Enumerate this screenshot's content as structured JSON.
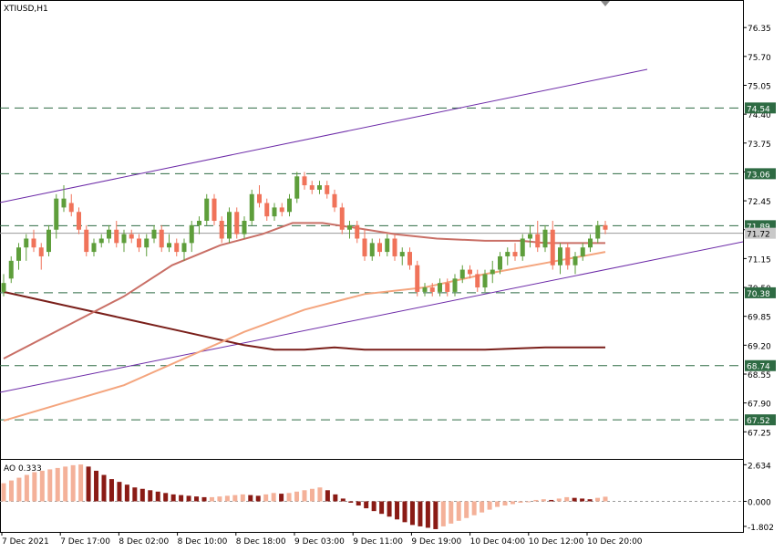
{
  "chart_data": {
    "type": "candlestick",
    "symbol": "XTIUSD,H1",
    "colors": {
      "up": "#5e9e3b",
      "down": "#f0735a",
      "ma_fast": "#c96f66",
      "ma_slow": "#f4a57e",
      "ma_long": "#7a1f1a",
      "channel": "#6d2ba8",
      "levels": "#2e6b43",
      "ao_up": "#f4b199",
      "ao_down": "#8a1b15"
    },
    "price_axis": {
      "ticks": [
        "76.35",
        "75.70",
        "75.05",
        "74.40",
        "73.75",
        "73.10",
        "72.45",
        "71.80",
        "71.15",
        "70.50",
        "69.85",
        "69.20",
        "68.55",
        "67.90",
        "67.25"
      ],
      "ylim": [
        66.64,
        76.97
      ]
    },
    "time_axis": {
      "labels": [
        "7 Dec 2021",
        "7 Dec 17:00",
        "8 Dec 02:00",
        "8 Dec 10:00",
        "8 Dec 18:00",
        "9 Dec 03:00",
        "9 Dec 11:00",
        "9 Dec 19:00",
        "10 Dec 04:00",
        "10 Dec 12:00",
        "10 Dec 20:00"
      ]
    },
    "levels": [
      {
        "label": "74.54",
        "value": 74.54
      },
      {
        "label": "73.06",
        "value": 73.06
      },
      {
        "label": "71.89",
        "value": 71.89
      },
      {
        "label": "70.38",
        "value": 70.38
      },
      {
        "label": "68.74",
        "value": 68.74
      },
      {
        "label": "67.52",
        "value": 67.52
      }
    ],
    "current_price": {
      "label": "71.72",
      "value": 71.72
    },
    "candles": [
      [
        70.4,
        70.8,
        70.3,
        70.6
      ],
      [
        70.7,
        71.2,
        70.6,
        71.1
      ],
      [
        71.1,
        71.5,
        70.9,
        71.4
      ],
      [
        71.4,
        71.7,
        71.1,
        71.6
      ],
      [
        71.6,
        71.8,
        71.3,
        71.4
      ],
      [
        71.4,
        71.5,
        70.9,
        71.2
      ],
      [
        71.3,
        71.9,
        71.2,
        71.8
      ],
      [
        71.8,
        72.6,
        71.6,
        72.5
      ],
      [
        72.3,
        72.8,
        72.2,
        72.5
      ],
      [
        72.4,
        72.6,
        72.1,
        72.2
      ],
      [
        72.2,
        72.3,
        71.7,
        71.8
      ],
      [
        71.8,
        71.9,
        71.2,
        71.3
      ],
      [
        71.3,
        71.6,
        71.2,
        71.5
      ],
      [
        71.5,
        71.7,
        71.4,
        71.6
      ],
      [
        71.6,
        71.9,
        71.5,
        71.8
      ],
      [
        71.8,
        72.0,
        71.4,
        71.5
      ],
      [
        71.5,
        71.8,
        71.3,
        71.7
      ],
      [
        71.7,
        71.8,
        71.5,
        71.6
      ],
      [
        71.6,
        71.7,
        71.3,
        71.4
      ],
      [
        71.4,
        71.7,
        71.2,
        71.6
      ],
      [
        71.6,
        71.9,
        71.5,
        71.8
      ],
      [
        71.8,
        71.9,
        71.3,
        71.4
      ],
      [
        71.4,
        71.7,
        71.3,
        71.5
      ],
      [
        71.5,
        71.6,
        71.2,
        71.3
      ],
      [
        71.3,
        71.6,
        71.1,
        71.5
      ],
      [
        71.5,
        72.0,
        71.3,
        71.9
      ],
      [
        71.9,
        72.1,
        71.7,
        72.0
      ],
      [
        72.0,
        72.6,
        71.9,
        72.5
      ],
      [
        72.5,
        72.6,
        71.9,
        72.0
      ],
      [
        72.0,
        72.1,
        71.5,
        71.6
      ],
      [
        71.6,
        72.3,
        71.5,
        72.2
      ],
      [
        72.2,
        72.3,
        71.6,
        71.7
      ],
      [
        71.7,
        72.1,
        71.6,
        72.0
      ],
      [
        72.0,
        72.7,
        71.9,
        72.6
      ],
      [
        72.6,
        72.8,
        72.3,
        72.4
      ],
      [
        72.4,
        72.5,
        72.0,
        72.1
      ],
      [
        72.1,
        72.4,
        72.0,
        72.3
      ],
      [
        72.3,
        72.4,
        72.1,
        72.2
      ],
      [
        72.2,
        72.6,
        72.1,
        72.5
      ],
      [
        72.5,
        73.1,
        72.4,
        73.0
      ],
      [
        73.0,
        73.1,
        72.7,
        72.8
      ],
      [
        72.8,
        72.9,
        72.6,
        72.7
      ],
      [
        72.7,
        72.9,
        72.6,
        72.8
      ],
      [
        72.8,
        72.9,
        72.5,
        72.6
      ],
      [
        72.6,
        72.7,
        72.2,
        72.3
      ],
      [
        72.3,
        72.4,
        71.7,
        71.8
      ],
      [
        71.8,
        72.0,
        71.6,
        71.9
      ],
      [
        71.9,
        72.0,
        71.5,
        71.6
      ],
      [
        71.6,
        71.8,
        71.1,
        71.2
      ],
      [
        71.2,
        71.6,
        71.1,
        71.5
      ],
      [
        71.5,
        71.6,
        71.2,
        71.3
      ],
      [
        71.3,
        71.7,
        71.2,
        71.6
      ],
      [
        71.6,
        71.7,
        71.1,
        71.2
      ],
      [
        71.2,
        71.4,
        71.0,
        71.3
      ],
      [
        71.3,
        71.4,
        70.9,
        71.0
      ],
      [
        71.0,
        71.1,
        70.3,
        70.4
      ],
      [
        70.4,
        70.6,
        70.3,
        70.5
      ],
      [
        70.5,
        70.6,
        70.3,
        70.4
      ],
      [
        70.4,
        70.7,
        70.3,
        70.6
      ],
      [
        70.6,
        70.7,
        70.3,
        70.4
      ],
      [
        70.4,
        70.8,
        70.3,
        70.7
      ],
      [
        70.7,
        71.0,
        70.6,
        70.9
      ],
      [
        70.9,
        71.0,
        70.7,
        70.8
      ],
      [
        70.8,
        70.9,
        70.4,
        70.5
      ],
      [
        70.5,
        70.9,
        70.4,
        70.8
      ],
      [
        70.8,
        71.1,
        70.6,
        70.9
      ],
      [
        70.9,
        71.3,
        70.8,
        71.2
      ],
      [
        71.2,
        71.4,
        71.0,
        71.3
      ],
      [
        71.3,
        71.5,
        71.1,
        71.2
      ],
      [
        71.2,
        71.7,
        71.1,
        71.6
      ],
      [
        71.6,
        71.9,
        71.4,
        71.7
      ],
      [
        71.7,
        72.0,
        71.3,
        71.4
      ],
      [
        71.4,
        71.9,
        71.3,
        71.8
      ],
      [
        71.8,
        72.0,
        70.9,
        71.0
      ],
      [
        71.0,
        71.5,
        70.8,
        71.4
      ],
      [
        71.4,
        71.5,
        70.9,
        71.0
      ],
      [
        71.0,
        71.3,
        70.8,
        71.2
      ],
      [
        71.2,
        71.5,
        71.1,
        71.4
      ],
      [
        71.4,
        71.7,
        71.3,
        71.6
      ],
      [
        71.6,
        72.0,
        71.5,
        71.9
      ],
      [
        71.9,
        72.0,
        71.7,
        71.8
      ]
    ],
    "ma_fast": [
      [
        0,
        68.9
      ],
      [
        0.1,
        69.6
      ],
      [
        0.2,
        70.3
      ],
      [
        0.28,
        71.0
      ],
      [
        0.36,
        71.45
      ],
      [
        0.43,
        71.7
      ],
      [
        0.48,
        71.95
      ],
      [
        0.53,
        71.95
      ],
      [
        0.58,
        71.85
      ],
      [
        0.65,
        71.7
      ],
      [
        0.72,
        71.6
      ],
      [
        0.8,
        71.55
      ],
      [
        0.86,
        71.55
      ],
      [
        0.9,
        71.5
      ],
      [
        1.0,
        71.5
      ]
    ],
    "ma_slow": [
      [
        0,
        67.5
      ],
      [
        0.1,
        67.9
      ],
      [
        0.2,
        68.3
      ],
      [
        0.3,
        68.9
      ],
      [
        0.4,
        69.5
      ],
      [
        0.5,
        70.0
      ],
      [
        0.6,
        70.35
      ],
      [
        0.7,
        70.5
      ],
      [
        0.8,
        70.8
      ],
      [
        0.9,
        71.05
      ],
      [
        1.0,
        71.3
      ]
    ],
    "ma_long": [
      [
        0,
        70.4
      ],
      [
        0.1,
        70.1
      ],
      [
        0.2,
        69.8
      ],
      [
        0.3,
        69.5
      ],
      [
        0.4,
        69.2
      ],
      [
        0.45,
        69.1
      ],
      [
        0.5,
        69.1
      ],
      [
        0.55,
        69.15
      ],
      [
        0.6,
        69.1
      ],
      [
        0.7,
        69.1
      ],
      [
        0.8,
        69.1
      ],
      [
        0.9,
        69.15
      ],
      [
        1.0,
        69.15
      ]
    ],
    "ao": {
      "label": "AO 0.333",
      "ticks": [
        "2.634",
        "0.000",
        "-1.802"
      ],
      "ylim": [
        -2.2,
        3.05
      ],
      "values": [
        1.3,
        1.5,
        1.7,
        1.9,
        2.1,
        2.2,
        2.3,
        2.4,
        2.5,
        2.6,
        2.65,
        2.5,
        2.2,
        1.9,
        1.6,
        1.4,
        1.2,
        1.0,
        0.9,
        0.8,
        0.7,
        0.6,
        0.5,
        0.45,
        0.4,
        0.35,
        0.3,
        0.3,
        0.35,
        0.4,
        0.45,
        0.5,
        0.45,
        0.4,
        0.5,
        0.6,
        0.55,
        0.6,
        0.7,
        0.8,
        0.9,
        1.0,
        0.8,
        0.5,
        0.2,
        -0.1,
        -0.3,
        -0.5,
        -0.7,
        -0.9,
        -1.1,
        -1.3,
        -1.5,
        -1.7,
        -1.8,
        -1.9,
        -2.0,
        -1.8,
        -1.6,
        -1.4,
        -1.2,
        -1.0,
        -0.8,
        -0.6,
        -0.4,
        -0.3,
        -0.2,
        -0.1,
        0.0,
        0.1,
        0.15,
        0.1,
        0.2,
        0.3,
        0.25,
        0.2,
        0.15,
        0.25,
        0.333
      ]
    }
  }
}
